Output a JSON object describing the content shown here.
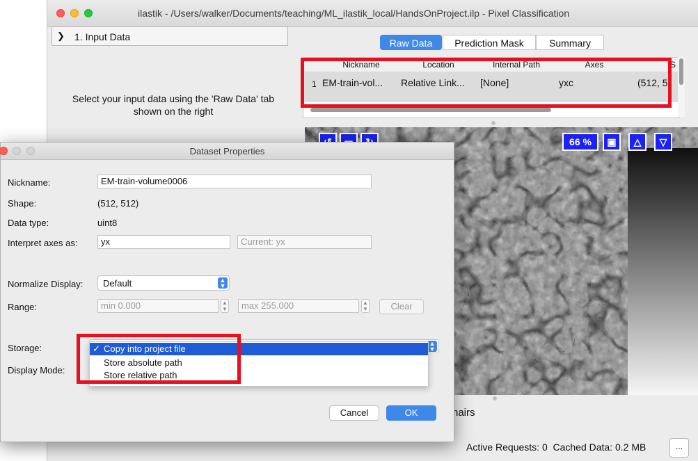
{
  "window": {
    "title": "ilastik - /Users/walker/Documents/teaching/ML_ilastik_local/HandsOnProject.ilp - Pixel Classification"
  },
  "left_pane": {
    "applet_header": "1. Input Data",
    "hint": "Select your input data using the 'Raw Data' tab shown on the right"
  },
  "tabs": [
    {
      "label": "Raw Data",
      "active": true
    },
    {
      "label": "Prediction Mask",
      "active": false
    },
    {
      "label": "Summary",
      "active": false
    }
  ],
  "table": {
    "headers": [
      "Nickname",
      "Location",
      "Internal Path",
      "Axes",
      "S"
    ],
    "rows": [
      {
        "index": "1",
        "cells": [
          "EM-train-vol...",
          "Relative Link...",
          "[None]",
          "yxc",
          "(512, 5"
        ]
      }
    ]
  },
  "viewer": {
    "zoom": "66 %",
    "icons": [
      "undo-icon",
      "square-icon",
      "redo-icon",
      "camera-icon",
      "triangle-up-icon",
      "triangle-down-icon"
    ],
    "crosshairs_label": "hairs"
  },
  "status": {
    "text": "Active Requests: 0  Cached Data: 0.2 MB",
    "more_button": "..."
  },
  "dialog": {
    "title": "Dataset Properties",
    "nickname_label": "Nickname:",
    "nickname_value": "EM-train-volume0006",
    "shape_label": "Shape:",
    "shape_value": "(512, 512)",
    "dtype_label": "Data type:",
    "dtype_value": "uint8",
    "axes_label": "Interpret axes as:",
    "axes_value": "yx",
    "axes_current": "Current: yx",
    "normalize_label": "Normalize Display:",
    "normalize_value": "Default",
    "range_label": "Range:",
    "range_min": "min 0.000",
    "range_max": "max 255.000",
    "clear_label": "Clear",
    "storage_label": "Storage:",
    "display_mode_label": "Display Mode:",
    "storage_options": [
      {
        "label": "Copy into project file",
        "selected": true
      },
      {
        "label": "Store absolute path",
        "selected": false
      },
      {
        "label": "Store relative path",
        "selected": false
      }
    ],
    "check_glyph": "✓",
    "cancel_label": "Cancel",
    "ok_label": "OK"
  },
  "colors": {
    "accent": "#3e88e8",
    "annotation_red": "#e8101e",
    "viewer_button_blue": "#1b22f2",
    "menu_selection": "#1f5bd6"
  }
}
